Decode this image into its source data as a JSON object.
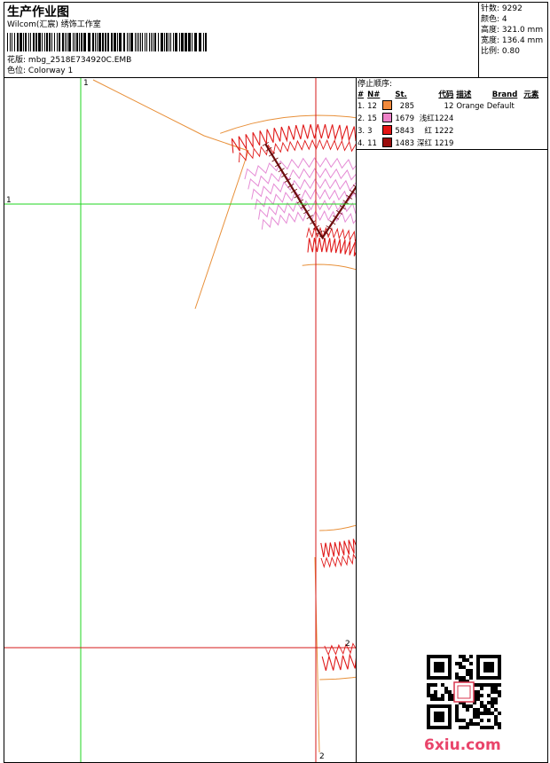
{
  "header": {
    "title": "生产作业图",
    "company": "Wilcom(汇宸) 绣饰工作室",
    "design_label": "花版:",
    "design_file": "mbg_2518E734920C.EMB",
    "colorway_label": "色位:",
    "colorway": "Colorway 1"
  },
  "stats": [
    {
      "label": "针数:",
      "value": "9292"
    },
    {
      "label": "颜色:",
      "value": "4"
    },
    {
      "label": "高度:",
      "value": "321.0 mm"
    },
    {
      "label": "宽度:",
      "value": "136.4 mm"
    },
    {
      "label": "比例:",
      "value": "0.80"
    }
  ],
  "stop_sequence": {
    "title": "停止顺序:",
    "columns": [
      "#",
      "N#",
      "St.",
      "代码",
      "描述",
      "Brand",
      "元素"
    ],
    "rows": [
      {
        "idx": "1.",
        "n": "12",
        "color": "#f28a3c",
        "st": "285",
        "code": "12",
        "desc": "Orange",
        "brand": "Default"
      },
      {
        "idx": "2.",
        "n": "15",
        "color": "#ee82c8",
        "st": "1679",
        "code": "浅红1224",
        "desc": "",
        "brand": ""
      },
      {
        "idx": "3.",
        "n": "3",
        "color": "#e31414",
        "st": "5843",
        "code": "红 1222",
        "desc": "",
        "brand": ""
      },
      {
        "idx": "4.",
        "n": "11",
        "color": "#9a0d0d",
        "st": "1483",
        "code": "深红 1219",
        "desc": "",
        "brand": ""
      }
    ]
  },
  "guides": {
    "v1": "1",
    "h1": "1",
    "h2": "2",
    "v2": "2"
  },
  "watermark": "6xiu.com",
  "colors": {
    "orange": "#e8903a",
    "pink": "#e58bd5",
    "red": "#e01a1a",
    "darkred": "#6b0c0c",
    "green": "#1fd41f"
  }
}
